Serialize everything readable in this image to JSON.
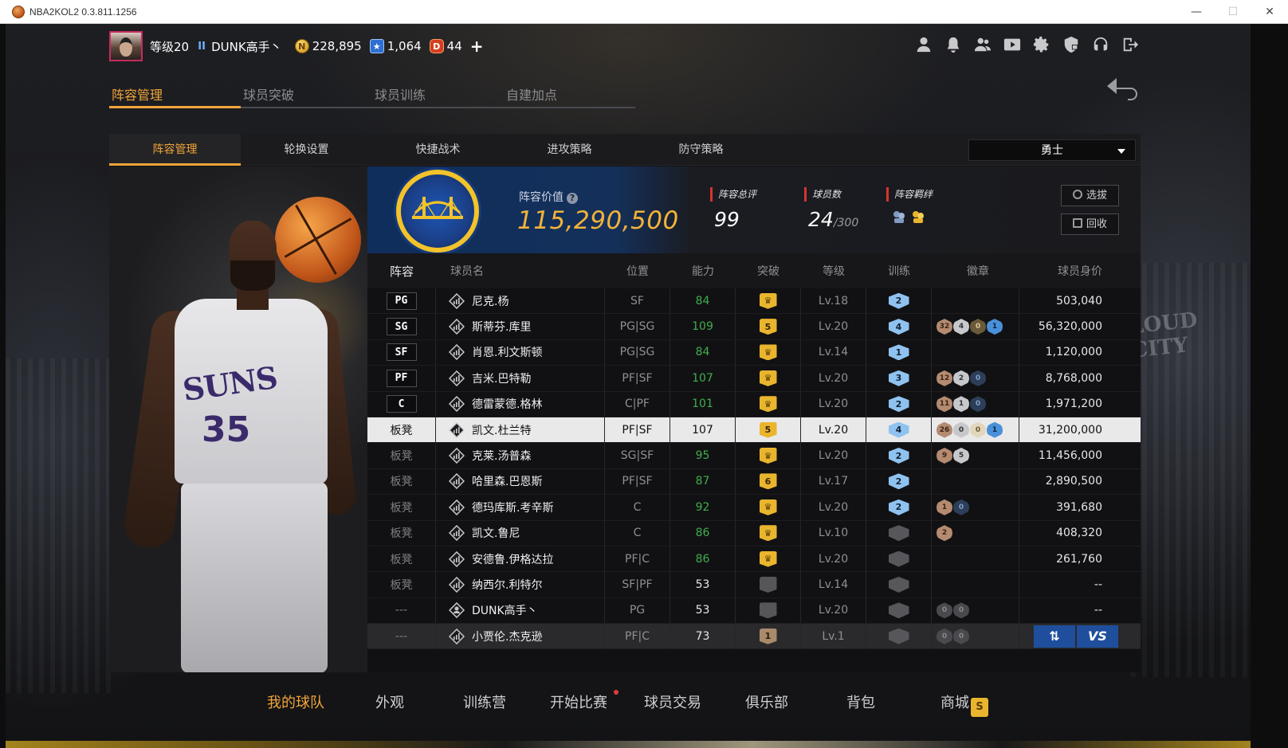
{
  "window": {
    "title": "NBA2KOL2 0.3.811.1256"
  },
  "header": {
    "level": "等级20",
    "rank_icon_glyph": "II",
    "username": "DUNK高手丶",
    "currencies": [
      {
        "icon": "coin-icon",
        "glyph": "N",
        "value": "228,895"
      },
      {
        "icon": "star-ticket-icon",
        "glyph": "★",
        "value": "1,064"
      },
      {
        "icon": "vip-point-icon",
        "glyph": "D",
        "value": "44"
      }
    ],
    "plus": "+"
  },
  "main_tabs": [
    {
      "label": "阵容管理",
      "active": true
    },
    {
      "label": "球员突破",
      "active": false
    },
    {
      "label": "球员训练",
      "active": false
    },
    {
      "label": "自建加点",
      "active": false
    }
  ],
  "sub_tabs": [
    {
      "label": "阵容管理",
      "active": true
    },
    {
      "label": "轮换设置",
      "active": false
    },
    {
      "label": "快捷战术",
      "active": false
    },
    {
      "label": "进攻策略",
      "active": false
    },
    {
      "label": "防守策略",
      "active": false
    }
  ],
  "team_select": {
    "value": "勇士"
  },
  "team_info": {
    "value_label": "阵容价值",
    "help_glyph": "?",
    "value": "115,290,500",
    "rating_label": "阵容总评",
    "rating": "99",
    "players_label": "球员数",
    "players": "24",
    "players_max": "/300",
    "bond_label": "阵容羁绊",
    "btn_select": "选拔",
    "btn_recycle": "回收"
  },
  "table": {
    "headers": {
      "lineup": "阵容",
      "name": "球员名",
      "position": "位置",
      "ability": "能力",
      "breakthrough": "突破",
      "level": "等级",
      "training": "训练",
      "badges": "徽章",
      "price": "球员身价"
    },
    "rows": [
      {
        "slot": "PG",
        "bench": false,
        "name": "尼克.杨",
        "pos": "SF",
        "ability": "84",
        "ab_color": "g",
        "bk": "crown",
        "bk_text": "♛",
        "lv": "Lv.18",
        "tr": "2",
        "badges": [],
        "price": "503,040"
      },
      {
        "slot": "SG",
        "bench": false,
        "name": "斯蒂芬.库里",
        "pos": "PG|SG",
        "ability": "109",
        "ab_color": "g",
        "bk": "num",
        "bk_text": "5",
        "lv": "Lv.20",
        "tr": "4",
        "badges": [
          [
            "bronze",
            "32"
          ],
          [
            "silver",
            "4"
          ],
          [
            "gold",
            "0"
          ],
          [
            "hof",
            "1"
          ]
        ],
        "price": "56,320,000"
      },
      {
        "slot": "SF",
        "bench": false,
        "name": "肖恩.利文斯顿",
        "pos": "PG|SG",
        "ability": "84",
        "ab_color": "g",
        "bk": "crown",
        "bk_text": "♛",
        "lv": "Lv.14",
        "tr": "1",
        "badges": [],
        "price": "1,120,000"
      },
      {
        "slot": "PF",
        "bench": false,
        "name": "吉米.巴特勒",
        "pos": "PF|SF",
        "ability": "107",
        "ab_color": "g",
        "bk": "crown",
        "bk_text": "♛",
        "lv": "Lv.20",
        "tr": "3",
        "badges": [
          [
            "bronze",
            "12"
          ],
          [
            "silver",
            "2"
          ],
          [
            "empty-blue",
            "0"
          ]
        ],
        "price": "8,768,000"
      },
      {
        "slot": "C",
        "bench": false,
        "name": "德雷蒙德.格林",
        "pos": "C|PF",
        "ability": "101",
        "ab_color": "g",
        "bk": "crown",
        "bk_text": "♛",
        "lv": "Lv.20",
        "tr": "2",
        "badges": [
          [
            "bronze",
            "11"
          ],
          [
            "silver",
            "1"
          ],
          [
            "empty-blue",
            "0"
          ]
        ],
        "price": "1,971,200"
      },
      {
        "slot": "板凳",
        "bench": true,
        "selected": true,
        "name": "凯文.杜兰特",
        "pos": "PF|SF",
        "ability": "107",
        "ab_color": "w",
        "bk": "num",
        "bk_text": "5",
        "lv": "Lv.20",
        "tr": "4",
        "badges": [
          [
            "bronze",
            "26"
          ],
          [
            "silver",
            "0"
          ],
          [
            "gold",
            "0"
          ],
          [
            "hof",
            "1"
          ]
        ],
        "price": "31,200,000"
      },
      {
        "slot": "板凳",
        "bench": true,
        "name": "克莱.汤普森",
        "pos": "SG|SF",
        "ability": "95",
        "ab_color": "g",
        "bk": "crown",
        "bk_text": "♛",
        "lv": "Lv.20",
        "tr": "2",
        "badges": [
          [
            "bronze",
            "9"
          ],
          [
            "silver",
            "5"
          ]
        ],
        "price": "11,456,000"
      },
      {
        "slot": "板凳",
        "bench": true,
        "name": "哈里森.巴恩斯",
        "pos": "PF|SF",
        "ability": "87",
        "ab_color": "g",
        "bk": "num",
        "bk_text": "6",
        "lv": "Lv.17",
        "tr": "2",
        "badges": [],
        "price": "2,890,500"
      },
      {
        "slot": "板凳",
        "bench": true,
        "name": "德玛库斯.考辛斯",
        "pos": "C",
        "ability": "92",
        "ab_color": "g",
        "bk": "crown",
        "bk_text": "♛",
        "lv": "Lv.20",
        "tr": "2",
        "badges": [
          [
            "bronze",
            "1"
          ],
          [
            "empty-blue",
            "0"
          ]
        ],
        "price": "391,680"
      },
      {
        "slot": "板凳",
        "bench": true,
        "name": "凯文.鲁尼",
        "pos": "C",
        "ability": "86",
        "ab_color": "g",
        "bk": "crown",
        "bk_text": "♛",
        "lv": "Lv.10",
        "tr": "",
        "tr_gray": true,
        "badges": [
          [
            "bronze",
            "2"
          ]
        ],
        "price": "408,320"
      },
      {
        "slot": "板凳",
        "bench": true,
        "name": "安德鲁.伊格达拉",
        "pos": "PF|C",
        "ability": "86",
        "ab_color": "g",
        "bk": "crown",
        "bk_text": "♛",
        "lv": "Lv.20",
        "tr": "",
        "tr_gray": true,
        "badges": [],
        "price": "261,760"
      },
      {
        "slot": "板凳",
        "bench": true,
        "name": "纳西尔.利特尔",
        "pos": "SF|PF",
        "ability": "53",
        "ab_color": "w",
        "bk": "gray",
        "bk_text": "",
        "lv": "Lv.14",
        "tr": "",
        "tr_gray": true,
        "badges": [],
        "price": "--"
      },
      {
        "slot": "---",
        "bench": true,
        "self": true,
        "name": "DUNK高手丶",
        "pos": "PG",
        "ability": "53",
        "ab_color": "w",
        "bk": "gray",
        "bk_text": "",
        "lv": "Lv.20",
        "tr": "",
        "tr_gray": true,
        "badges": [
          [
            "dim",
            "0"
          ],
          [
            "dim",
            "0"
          ]
        ],
        "price": "--"
      },
      {
        "slot": "---",
        "bench": true,
        "last": true,
        "name": "小贾伦.杰克逊",
        "pos": "PF|C",
        "ability": "73",
        "ab_color": "w",
        "bk": "brown",
        "bk_text": "1",
        "lv": "Lv.1",
        "tr": "",
        "tr_gray": true,
        "badges": [
          [
            "dim",
            "0"
          ],
          [
            "dim",
            "0"
          ]
        ],
        "price": "",
        "actions": [
          "⇅",
          "VS"
        ]
      }
    ]
  },
  "bottom_nav": [
    {
      "label": "我的球队",
      "active": true
    },
    {
      "label": "外观",
      "active": false
    },
    {
      "label": "训练营",
      "active": false
    },
    {
      "label": "开始比赛",
      "active": false,
      "dot": true
    },
    {
      "label": "球员交易",
      "active": false
    },
    {
      "label": "俱乐部",
      "active": false
    },
    {
      "label": "背包",
      "active": false
    },
    {
      "label": "商城",
      "active": false,
      "badge": "S"
    }
  ],
  "art": {
    "jersey_text": "SUNS",
    "jersey_number": "35"
  },
  "background": {
    "banner_text": "LOUD CITY"
  },
  "colors": {
    "accent": "#f1a53a",
    "ability_green": "#3fae4c",
    "panel": "#111113",
    "team_blue": "#1d57b5",
    "team_gold": "#f2c32a"
  }
}
